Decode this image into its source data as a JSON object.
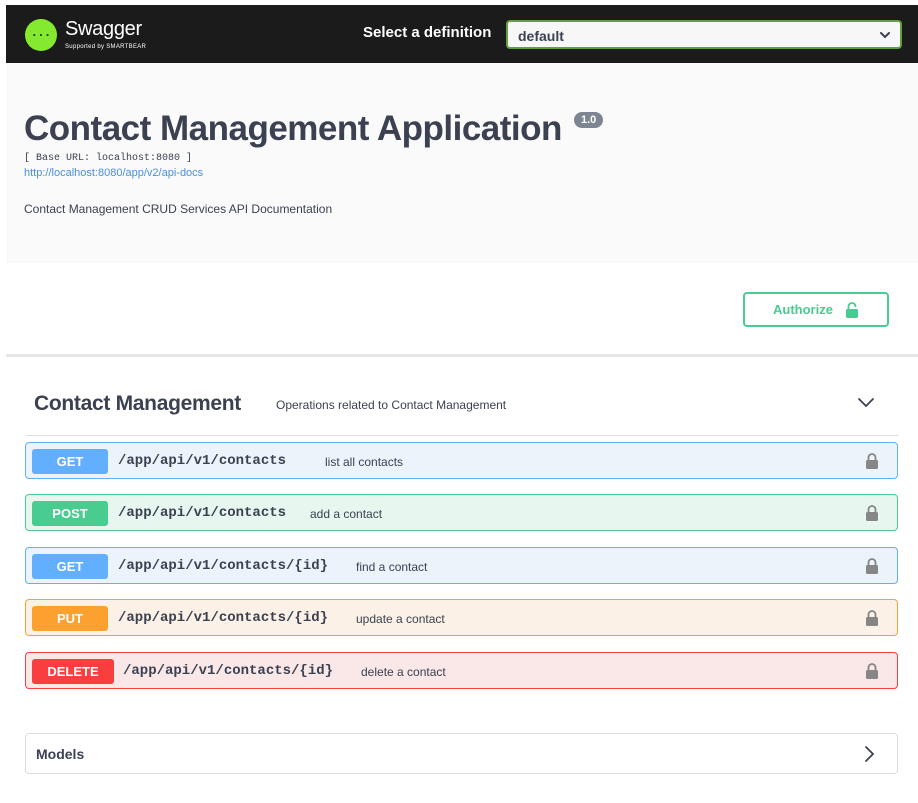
{
  "topbar": {
    "logo_name": "Swagger",
    "logo_sub": "Supported by SMARTBEAR",
    "select_label": "Select a definition",
    "selected_definition": "default"
  },
  "info": {
    "title": "Contact Management Application",
    "version": "1.0",
    "base_url": "[ Base URL: localhost:8080 ]",
    "api_docs_link": "http://localhost:8080/app/v2/api-docs",
    "description": "Contact Management CRUD Services API Documentation"
  },
  "authorize": {
    "label": "Authorize"
  },
  "tag": {
    "name": "Contact Management",
    "description": "Operations related to Contact Management"
  },
  "operations": [
    {
      "method": "GET",
      "path": "/app/api/v1/contacts",
      "summary": "list all contacts"
    },
    {
      "method": "POST",
      "path": "/app/api/v1/contacts",
      "summary": "add a contact"
    },
    {
      "method": "GET",
      "path": "/app/api/v1/contacts/{id}",
      "summary": "find a contact"
    },
    {
      "method": "PUT",
      "path": "/app/api/v1/contacts/{id}",
      "summary": "update a contact"
    },
    {
      "method": "DELETE",
      "path": "/app/api/v1/contacts/{id}",
      "summary": "delete a contact"
    }
  ],
  "models": {
    "label": "Models"
  },
  "colors": {
    "get": "#61affe",
    "post": "#49cc90",
    "put": "#fca130",
    "delete": "#f93e3e",
    "swagger_green": "#85ea2d",
    "topbar_bg": "#1b1b1b"
  },
  "icons": {
    "logo": "swagger-logo-icon",
    "select_chevron": "chevron-down-icon",
    "authorize_lock": "lock-icon",
    "tag_chevron": "chevron-down-icon",
    "operation_lock": "lock-icon",
    "models_chevron": "chevron-right-icon"
  }
}
